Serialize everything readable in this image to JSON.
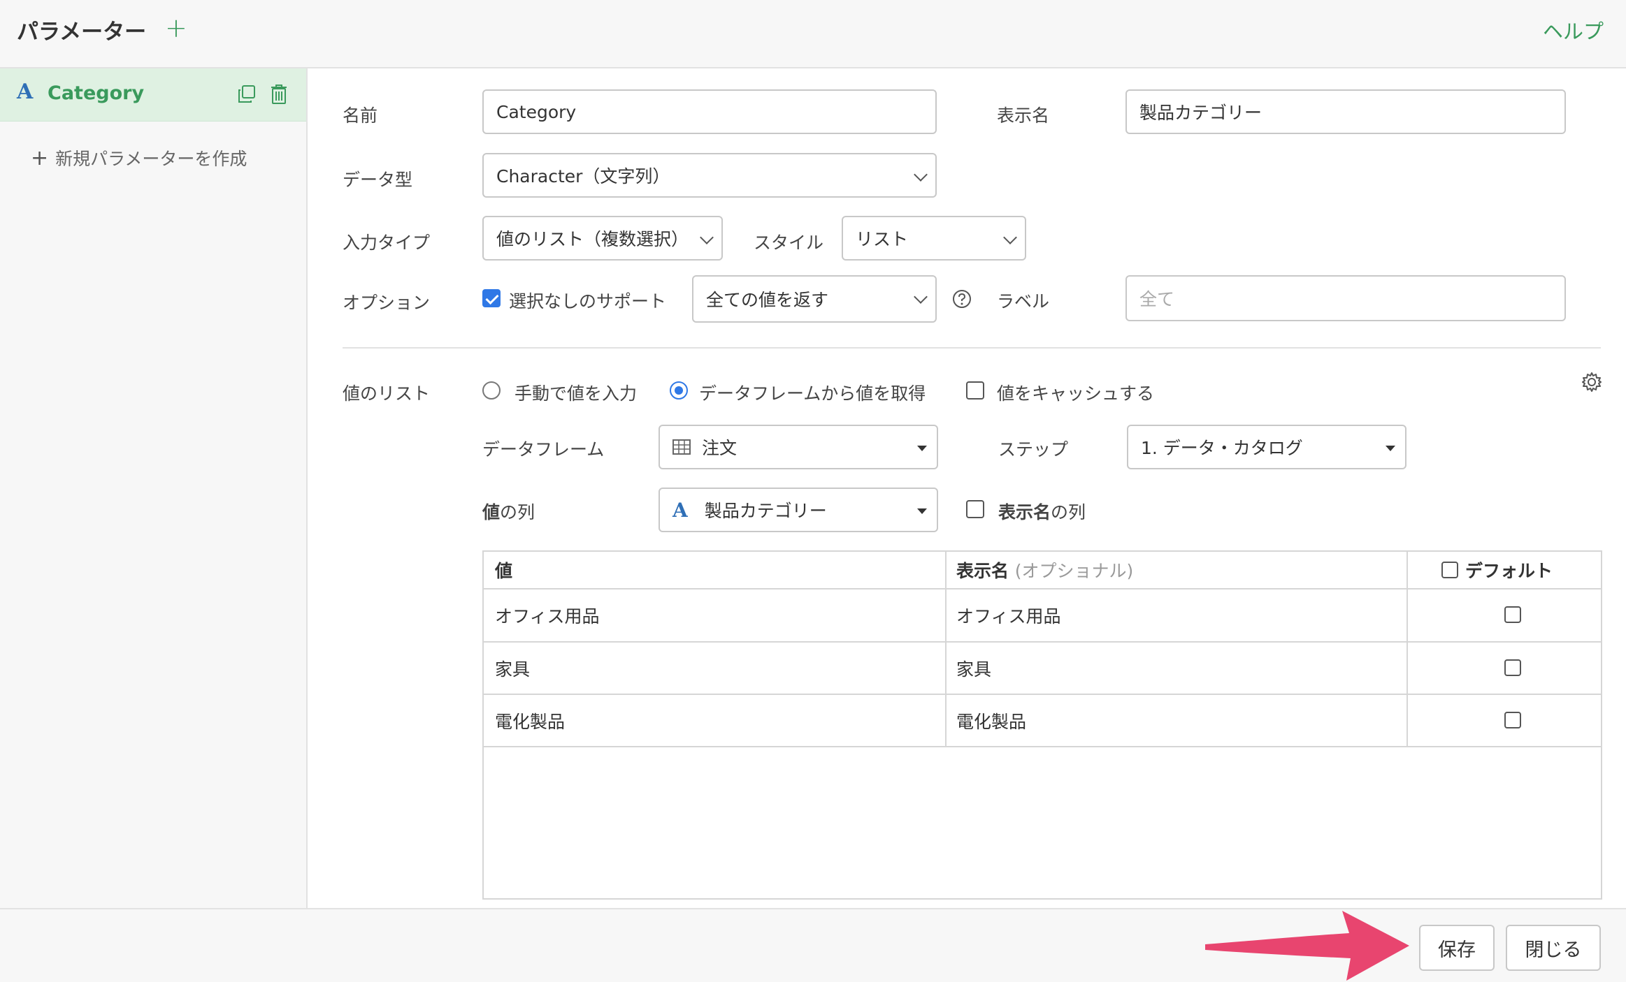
{
  "header": {
    "title": "パラメーター",
    "add_icon": "plus-icon",
    "help_label": "ヘルプ"
  },
  "sidebar": {
    "items": [
      {
        "type_letter": "A",
        "label": "Category"
      }
    ],
    "new_param_label": "新規パラメーターを作成"
  },
  "form": {
    "name_label": "名前",
    "name_value": "Category",
    "display_name_label": "表示名",
    "display_name_value": "製品カテゴリー",
    "data_type_label": "データ型",
    "data_type_value": "Character（文字列）",
    "input_type_label": "入力タイプ",
    "input_type_value": "値のリスト（複数選択）",
    "style_label": "スタイル",
    "style_value": "リスト",
    "option_label": "オプション",
    "support_none_label": "選択なしのサポート",
    "support_none_checked": true,
    "return_value": "全ての値を返す",
    "label_label": "ラベル",
    "label_placeholder": "全て"
  },
  "value_list": {
    "section_label": "値のリスト",
    "manual_label": "手動で値を入力",
    "from_df_label": "データフレームから値を取得",
    "cache_label": "値をキャッシュする",
    "dataframe_label": "データフレーム",
    "dataframe_value": "注文",
    "step_label": "ステップ",
    "step_value": "1. データ・カタログ",
    "value_col_label_bold": "値",
    "value_col_label_rest": "の列",
    "value_col_letter": "A",
    "value_col_value": "製品カテゴリー",
    "display_col_label_bold": "表示名",
    "display_col_label_rest": "の列"
  },
  "table": {
    "headers": {
      "value": "値",
      "display": "表示名",
      "display_optional": "(オプショナル)",
      "default": "デフォルト"
    },
    "rows": [
      {
        "value": "オフィス用品",
        "display": "オフィス用品"
      },
      {
        "value": "家具",
        "display": "家具"
      },
      {
        "value": "電化製品",
        "display": "電化製品"
      }
    ]
  },
  "footer": {
    "save_label": "保存",
    "close_label": "閉じる"
  },
  "colors": {
    "accent_green": "#3a9a5c",
    "accent_blue": "#2f78e6",
    "arrow": "#e8456f"
  }
}
